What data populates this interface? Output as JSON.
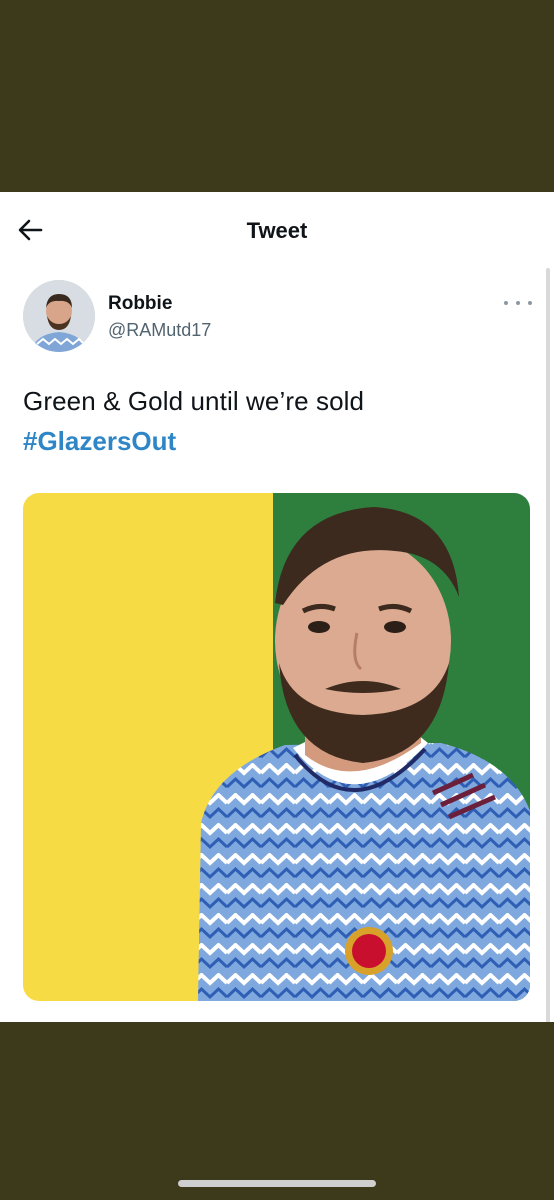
{
  "header": {
    "title": "Tweet",
    "back_icon": "arrow-left-icon"
  },
  "author": {
    "name": "Robbie",
    "handle": "@RAMutd17"
  },
  "more_icon": "more-horizontal-icon",
  "tweet": {
    "text": "Green & Gold until we’re sold",
    "hashtag": "#GlazersOut"
  },
  "colors": {
    "background_band": "#3d3a1c",
    "hashtag": "#2f86c6",
    "media_yellow": "#f6db45",
    "media_green": "#2e7f3e"
  }
}
